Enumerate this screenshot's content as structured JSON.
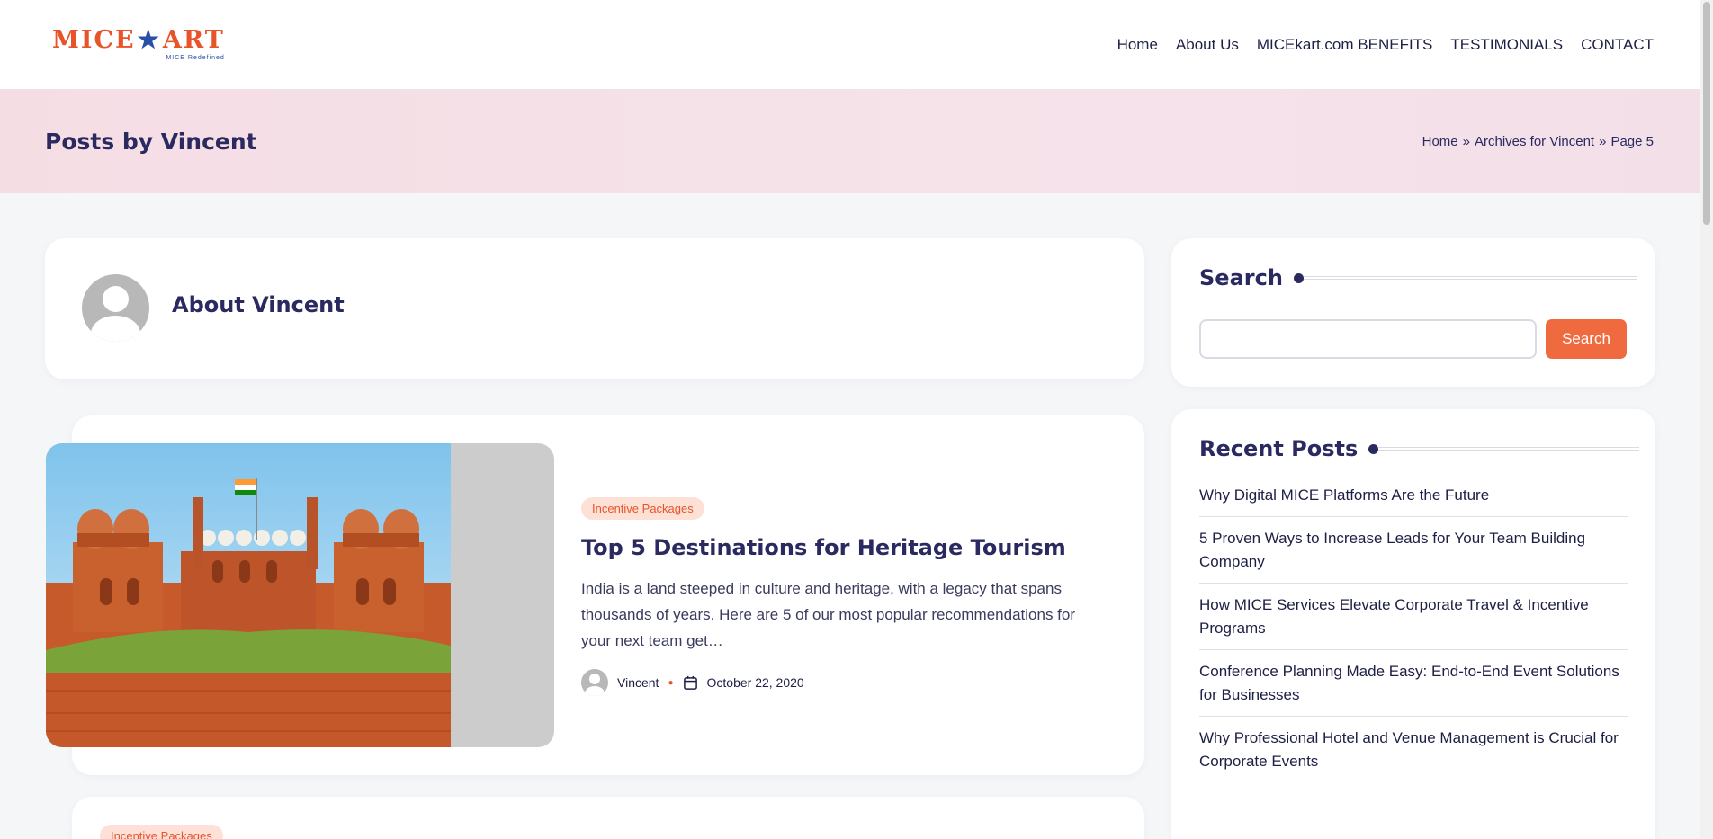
{
  "header": {
    "logo_text": "MICE",
    "logo_text_2": "ART",
    "logo_tagline": "MICE Redefined",
    "nav": [
      "Home",
      "About Us",
      "MICEkart.com BENEFITS",
      "TESTIMONIALS",
      "CONTACT"
    ]
  },
  "banner": {
    "title": "Posts by Vincent",
    "breadcrumb": {
      "home": "Home",
      "sep": "»",
      "archives": "Archives for Vincent",
      "page": "Page 5"
    }
  },
  "about": {
    "title": "About Vincent"
  },
  "post": {
    "category": "Incentive Packages",
    "title": "Top 5 Destinations for Heritage Tourism",
    "excerpt": "India is a land steeped in culture and heritage, with a legacy that spans thousands of years. Here are 5 of our most popular recommendations for your next team get…",
    "author": "Vincent",
    "date": "October 22, 2020"
  },
  "next_post": {
    "category": "Incentive Packages"
  },
  "sidebar": {
    "search": {
      "title": "Search",
      "button_label": "Search",
      "placeholder": ""
    },
    "recent": {
      "title": "Recent Posts",
      "items": [
        "Why Digital MICE Platforms Are the Future",
        "5 Proven Ways to Increase Leads for Your Team Building Company",
        "How MICE Services Elevate Corporate Travel & Incentive Programs",
        "Conference Planning Made Easy: End-to-End Event Solutions for Businesses",
        "Why Professional Hotel and Venue Management is Crucial for Corporate Events"
      ]
    }
  },
  "colors": {
    "accent": "#ef6a3f",
    "navy": "#2a2960",
    "badge_bg": "#fde0d6",
    "banner_bg": "#f5dde4"
  }
}
